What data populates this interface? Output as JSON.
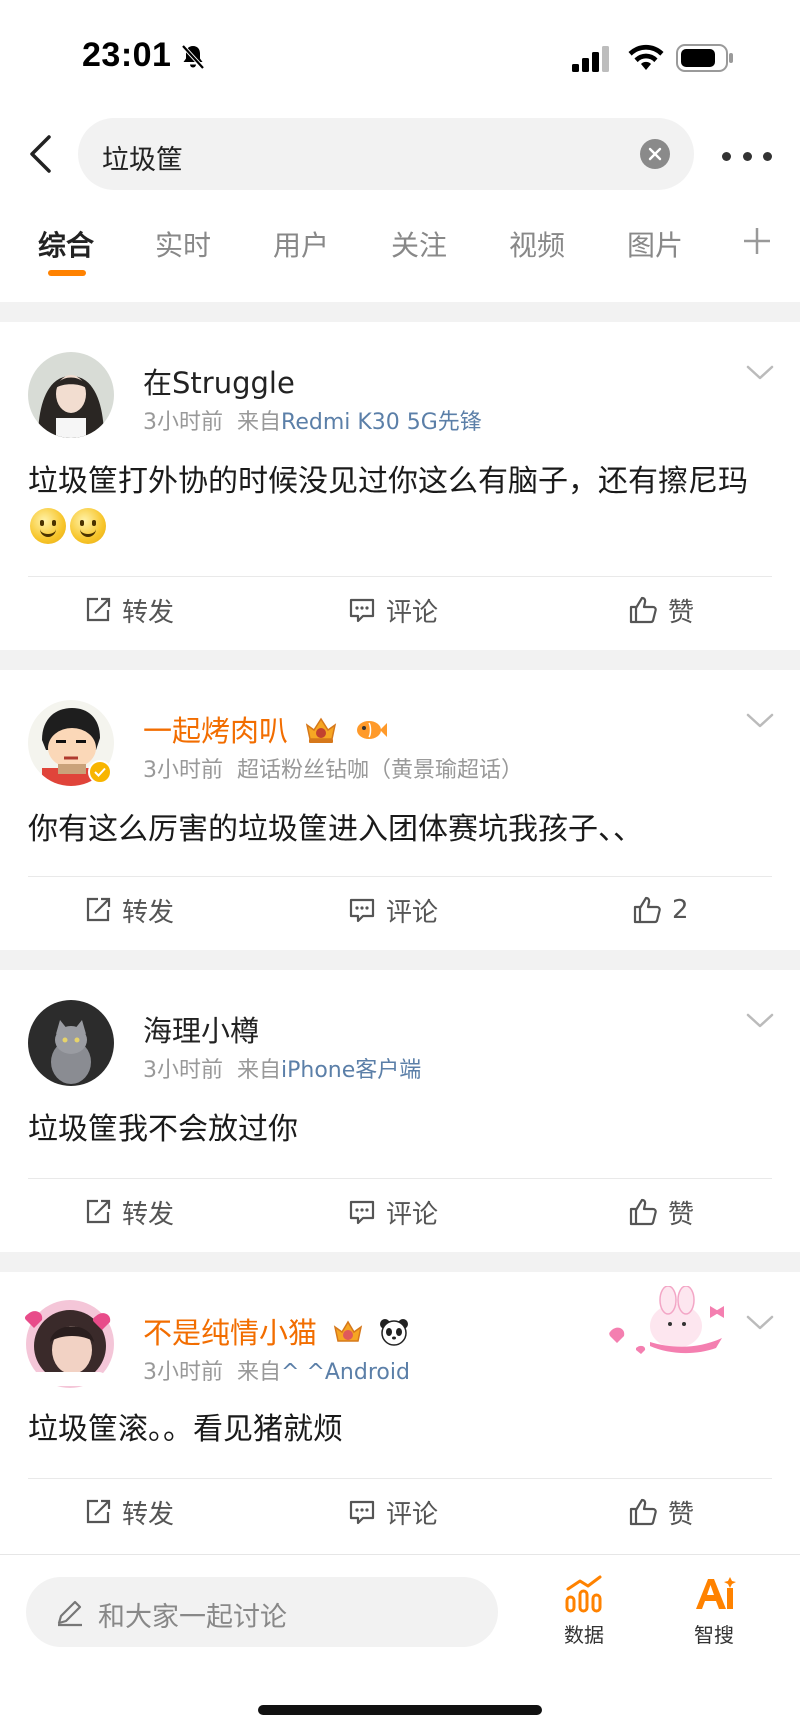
{
  "status_bar": {
    "time": "23:01"
  },
  "search": {
    "query": "垃圾筐"
  },
  "tabs": [
    {
      "label": "综合",
      "active": true
    },
    {
      "label": "实时"
    },
    {
      "label": "用户"
    },
    {
      "label": "关注"
    },
    {
      "label": "视频"
    },
    {
      "label": "图片"
    }
  ],
  "posts": [
    {
      "username": "在Struggle",
      "time": "3小时前",
      "source_prefix": "来自",
      "source": "Redmi K30 5G先锋",
      "text": "垃圾筐打外协的时候没见过你这么有脑子，还有擦尼玛",
      "repost": "转发",
      "comment": "评论",
      "like": "赞"
    },
    {
      "username": "一起烤肉叭",
      "time": "3小时前",
      "source": "超话粉丝钻咖（黄景瑜超话）",
      "text": "你有这么厉害的垃圾筐进入团体赛坑我孩子、、",
      "repost": "转发",
      "comment": "评论",
      "like": "2"
    },
    {
      "username": "海理小樽",
      "time": "3小时前",
      "source_prefix": "来自",
      "source": "iPhone客户端",
      "text": "垃圾筐我不会放过你",
      "repost": "转发",
      "comment": "评论",
      "like": "赞"
    },
    {
      "username": "不是纯情小猫",
      "time": "3小时前",
      "source_prefix": "来自",
      "source": "^ ^Android",
      "text": "垃圾筐滚。。看见猪就烦",
      "repost": "转发",
      "comment": "评论",
      "like": "赞"
    }
  ],
  "bottom_bar": {
    "comment_placeholder": "和大家一起讨论",
    "data_label": "数据",
    "ai_label": "智搜"
  },
  "colors": {
    "accent": "#ff8200",
    "link": "#5b7fa8",
    "vip_name": "#f26d00"
  }
}
